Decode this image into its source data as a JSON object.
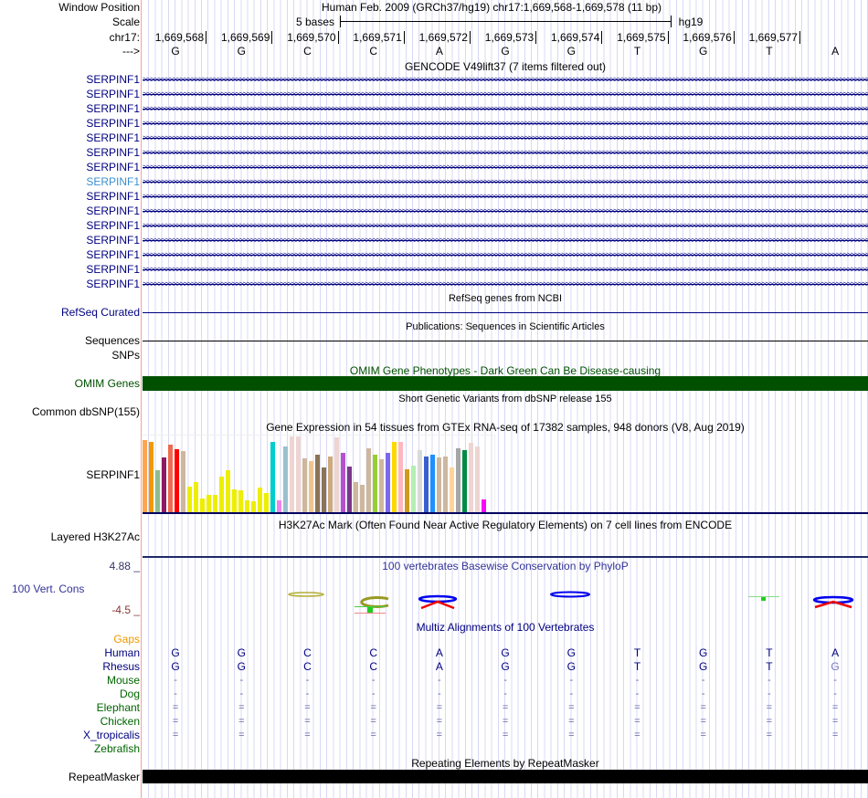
{
  "header": {
    "window_label": "Window Position",
    "window_text": "Human Feb. 2009 (GRCh37/hg19)   chr17:1,669,568-1,669,578 (11 bp)",
    "scale_label": "Scale",
    "scale_text": "5 bases",
    "assembly": "hg19",
    "chrom_label": "chr17:",
    "strand_label": "--->"
  },
  "ruler": [
    "1,669,568",
    "1,669,569",
    "1,669,570",
    "1,669,571",
    "1,669,572",
    "1,669,573",
    "1,669,574",
    "1,669,575",
    "1,669,576",
    "1,669,577"
  ],
  "bases": [
    "G",
    "G",
    "C",
    "C",
    "A",
    "G",
    "G",
    "T",
    "G",
    "T",
    "A"
  ],
  "gencode": {
    "title": "GENCODE V49lift37 (7 items filtered out)",
    "rows": [
      "SERPINF1",
      "SERPINF1",
      "SERPINF1",
      "SERPINF1",
      "SERPINF1",
      "SERPINF1",
      "SERPINF1",
      "SERPINF1",
      "SERPINF1",
      "SERPINF1",
      "SERPINF1",
      "SERPINF1",
      "SERPINF1",
      "SERPINF1",
      "SERPINF1"
    ],
    "highlighted_index": 7
  },
  "refseq": {
    "title": "RefSeq genes from NCBI",
    "label": "RefSeq Curated"
  },
  "pubs": {
    "title": "Publications: Sequences in Scientific Articles",
    "label": "Sequences"
  },
  "snps": {
    "label": "SNPs"
  },
  "omim": {
    "title": "OMIM Gene Phenotypes - Dark Green Can Be Disease-causing",
    "label": "OMIM Genes",
    "color": "#005000"
  },
  "dbsnp": {
    "title": "Short Genetic Variants from dbSNP release 155",
    "label": "Common dbSNP(155)"
  },
  "gtex": {
    "title": "Gene Expression in 54 tissues from GTEx RNA-seq of 17382 samples, 948 donors (V8, Aug 2019)",
    "label": "SERPINF1",
    "values": [
      0.95,
      0.93,
      0.56,
      0.73,
      0.89,
      0.83,
      0.81,
      0.34,
      0.4,
      0.19,
      0.24,
      0.24,
      0.48,
      0.56,
      0.31,
      0.3,
      0.17,
      0.16,
      0.33,
      0.26,
      0.93,
      0.17,
      0.87,
      1.0,
      1.0,
      0.72,
      0.68,
      0.76,
      0.6,
      0.74,
      0.99,
      0.79,
      0.61,
      0.4,
      0.37,
      0.85,
      0.76,
      0.7,
      0.78,
      0.93,
      0.93,
      0.57,
      0.62,
      0.82,
      0.74,
      0.76,
      0.73,
      0.74,
      0.6,
      0.85,
      0.82,
      0.92,
      0.87,
      0.18
    ],
    "colors": [
      "#ffa54f",
      "#ee9a00",
      "#8fbc8f",
      "#8b1c62",
      "#ee6a50",
      "#ff0000",
      "#cdb79e",
      "#eeee00",
      "#eeee00",
      "#eeee00",
      "#eeee00",
      "#eeee00",
      "#eeee00",
      "#eeee00",
      "#eeee00",
      "#eeee00",
      "#eeee00",
      "#eeee00",
      "#eeee00",
      "#eeee00",
      "#00cdcd",
      "#ee82ee",
      "#9ac0cd",
      "#eed5d2",
      "#eed5d2",
      "#cdb79e",
      "#eec591",
      "#8b7355",
      "#8b7355",
      "#cdaa7d",
      "#eed5d2",
      "#b452cd",
      "#7a378b",
      "#cdb79e",
      "#cdb79e",
      "#cdb79e",
      "#9acd32",
      "#cdb79e",
      "#7b68ee",
      "#ffd700",
      "#ffb6c1",
      "#cd9b1d",
      "#b4eeb4",
      "#d9d9d9",
      "#3a5fcd",
      "#1e90ff",
      "#cdb79e",
      "#cdb79e",
      "#ffd39b",
      "#a6a6a6",
      "#008b45",
      "#eed5d2",
      "#eed5d2",
      "#ff00ff"
    ]
  },
  "h3k27ac": {
    "title": "H3K27Ac Mark (Often Found Near Active Regulatory Elements) on 7 cell lines from ENCODE",
    "label": "Layered H3K27Ac"
  },
  "cons": {
    "title": "100 vertebrates Basewise Conservation by PhyloP",
    "label": "100 Vert. Cons",
    "max": "4.88 _",
    "min": "-4.5 _"
  },
  "multiz": {
    "title": "Multiz Alignments of 100 Vertebrates",
    "gaps_label": "Gaps",
    "species": [
      {
        "name": "Human",
        "bases": [
          "G",
          "G",
          "C",
          "C",
          "A",
          "G",
          "G",
          "T",
          "G",
          "T",
          "A"
        ]
      },
      {
        "name": "Rhesus",
        "bases": [
          "G",
          "G",
          "C",
          "C",
          "A",
          "G",
          "G",
          "T",
          "G",
          "T",
          "G"
        ]
      },
      {
        "name": "Mouse",
        "bases": [
          "-",
          "-",
          "-",
          "-",
          "-",
          "-",
          "-",
          "-",
          "-",
          "-",
          "-"
        ]
      },
      {
        "name": "Dog",
        "bases": [
          "-",
          "-",
          "-",
          "-",
          "-",
          "-",
          "-",
          "-",
          "-",
          "-",
          "-"
        ]
      },
      {
        "name": "Elephant",
        "bases": [
          "=",
          "=",
          "=",
          "=",
          "=",
          "=",
          "=",
          "=",
          "=",
          "=",
          "="
        ]
      },
      {
        "name": "Chicken",
        "bases": [
          "=",
          "=",
          "=",
          "=",
          "=",
          "=",
          "=",
          "=",
          "=",
          "=",
          "="
        ]
      },
      {
        "name": "X_tropicalis",
        "bases": [
          "=",
          "=",
          "=",
          "=",
          "=",
          "=",
          "=",
          "=",
          "=",
          "=",
          "="
        ]
      },
      {
        "name": "Zebrafish",
        "bases": []
      }
    ]
  },
  "rmsk": {
    "title": "Repeating Elements by RepeatMasker",
    "label": "RepeatMasker"
  }
}
